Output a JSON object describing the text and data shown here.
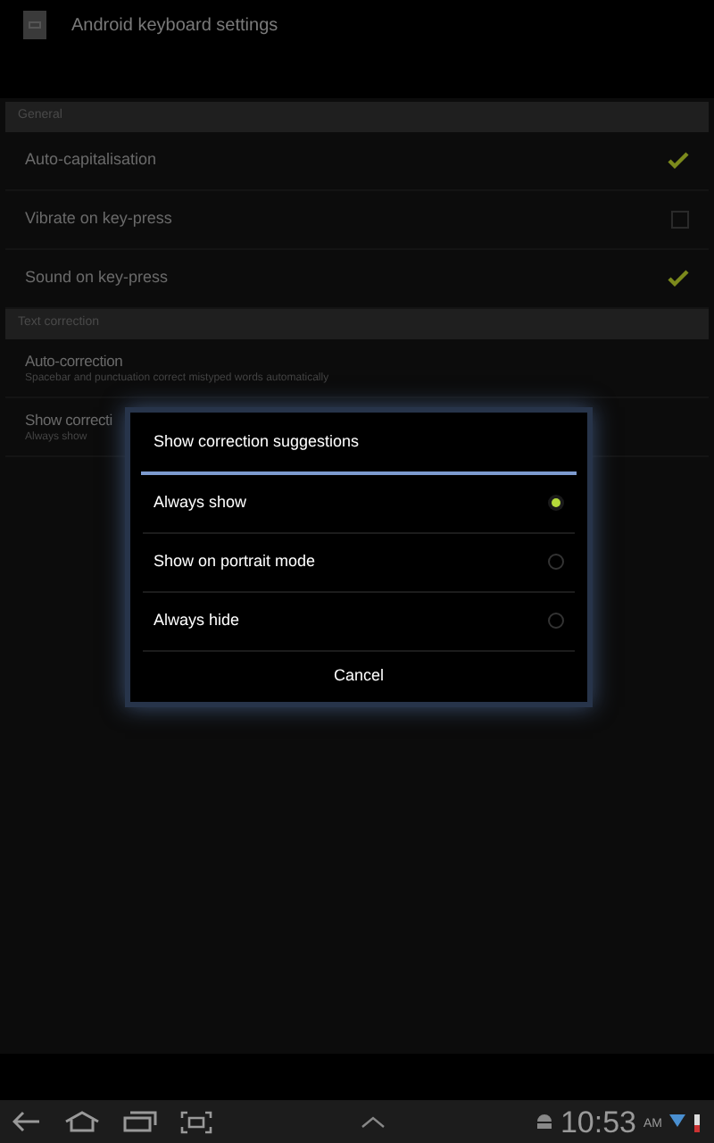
{
  "app_bar": {
    "title": "Android keyboard settings"
  },
  "sections": [
    {
      "header": "General",
      "items": [
        {
          "kind": "checkbox",
          "title": "Auto-capitalisation",
          "checked": true
        },
        {
          "kind": "checkbox",
          "title": "Vibrate on key-press",
          "checked": false
        },
        {
          "kind": "checkbox",
          "title": "Sound on key-press",
          "checked": true
        }
      ]
    },
    {
      "header": "Text correction",
      "items": [
        {
          "kind": "text",
          "title": "Auto-correction",
          "summary": "Spacebar and punctuation correct mistyped words automatically"
        },
        {
          "kind": "text",
          "title": "Show correcti",
          "summary": "Always show"
        }
      ]
    }
  ],
  "dialog": {
    "title": "Show correction suggestions",
    "options": [
      {
        "label": "Always show",
        "selected": true
      },
      {
        "label": "Show on portrait mode",
        "selected": false
      },
      {
        "label": "Always hide",
        "selected": false
      }
    ],
    "cancel": "Cancel"
  },
  "status_bar": {
    "time": "10:53",
    "ampm": "AM"
  }
}
